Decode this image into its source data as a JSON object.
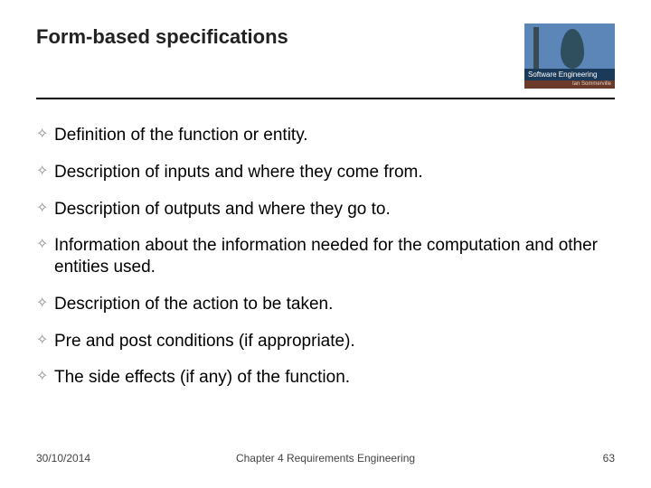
{
  "title": "Form-based specifications",
  "thumb": {
    "label": "Software Engineering",
    "sub": "Ian Sommerville"
  },
  "bullets": [
    "Definition of the function or entity.",
    "Description of inputs and where they come from.",
    "Description of outputs and where they go to.",
    "Information about the information needed for the computation and other entities used.",
    "Description of the action to be taken.",
    "Pre and post conditions (if appropriate).",
    "The side effects (if any) of the function."
  ],
  "footer": {
    "date": "30/10/2014",
    "chapter": "Chapter 4 Requirements Engineering",
    "page": "63"
  }
}
